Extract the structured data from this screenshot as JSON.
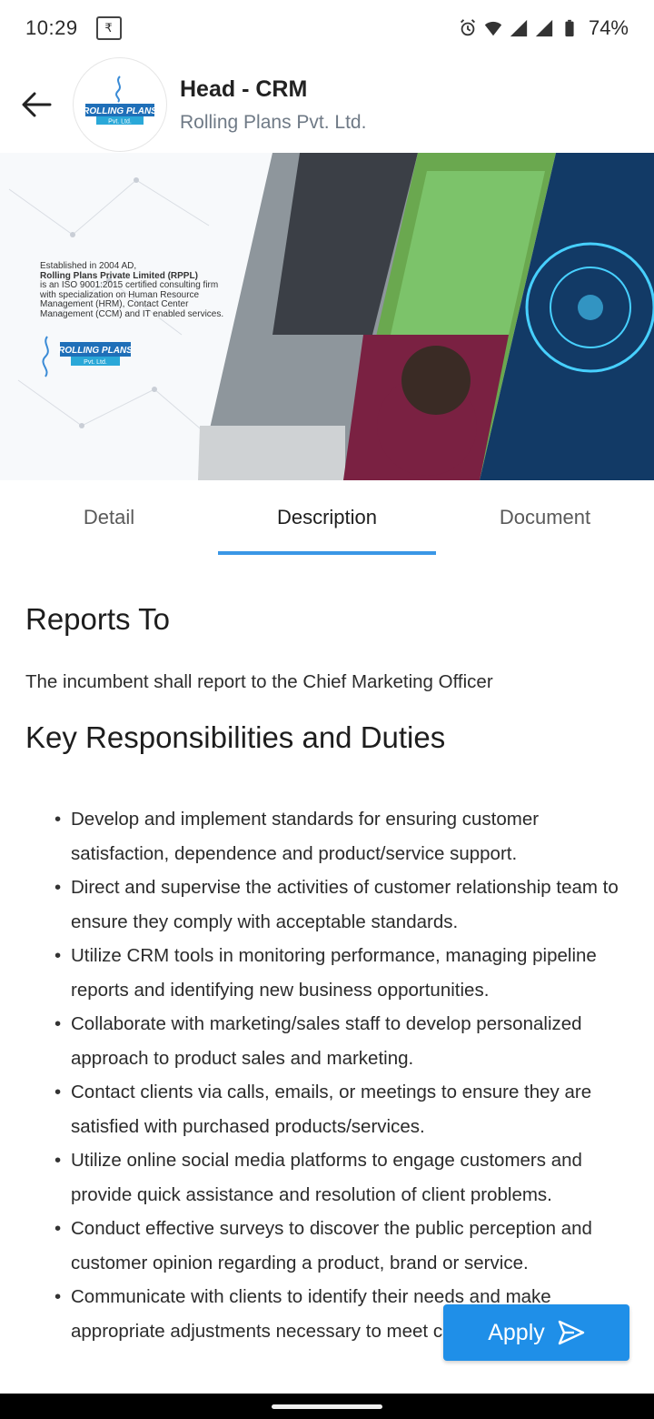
{
  "status_bar": {
    "time": "10:29",
    "battery": "74%",
    "icons": [
      "app-badge-icon",
      "alarm-icon",
      "wifi-icon",
      "signal-icon",
      "signal-icon",
      "battery-icon"
    ]
  },
  "header": {
    "title": "Head - CRM",
    "company": "Rolling Plans Pvt. Ltd.",
    "logo_text": "ROLLING PLANS",
    "logo_sub": "Pvt. Ltd.",
    "back_icon": "arrow-left-icon"
  },
  "banner": {
    "line1": "Established in 2004 AD,",
    "line2": "Rolling Plans Private Limited (RPPL)",
    "line3": "is an ISO 9001:2015 certified consulting firm with specialization on Human Resource Management (HRM), Contact Center Management (CCM) and IT enabled services.",
    "logo_text": "ROLLING PLANS",
    "logo_sub": "Pvt. Ltd."
  },
  "tabs": [
    {
      "label": "Detail",
      "active": false
    },
    {
      "label": "Description",
      "active": true
    },
    {
      "label": "Document",
      "active": false
    }
  ],
  "content": {
    "reports_heading": "Reports To",
    "reports_text": "The incumbent shall report to the Chief Marketing Officer",
    "duties_heading": "Key Responsibilities and Duties",
    "duties": [
      "Develop and implement standards for ensuring customer satisfaction, dependence and product/service support.",
      "Direct and supervise the activities of customer relationship team to ensure they comply with acceptable standards.",
      "Utilize CRM tools in monitoring performance, managing pipeline reports and identifying new business opportunities.",
      "Collaborate with marketing/sales staff to develop personalized approach to product sales and marketing.",
      "Contact clients via calls, emails, or meetings to ensure they are satisfied with purchased products/services.",
      "Utilize online social media platforms to engage customers and provide quick assistance and resolution of client problems.",
      "Conduct effective surveys to discover the public perception and customer opinion regarding a product, brand or service.",
      "Communicate with clients to identify their needs and make appropriate adjustments necessary to meet client needs."
    ]
  },
  "apply": {
    "label": "Apply",
    "icon": "send-icon"
  },
  "colors": {
    "accent": "#1f8fe8",
    "tab_indicator": "#3a97e6",
    "company_text": "#6f7a86"
  }
}
